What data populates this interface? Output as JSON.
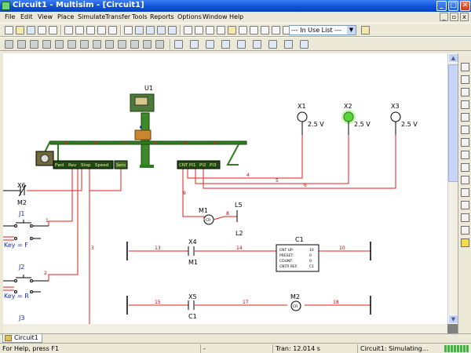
{
  "window": {
    "title": "Circuit1 - Multisim - [Circuit1]"
  },
  "title_buttons": [
    "_",
    "□",
    "✕"
  ],
  "menu": [
    {
      "label": "File"
    },
    {
      "label": "Edit"
    },
    {
      "label": "View"
    },
    {
      "label": "Place"
    },
    {
      "label": "Simulate"
    },
    {
      "label": "Transfer"
    },
    {
      "label": "Tools"
    },
    {
      "label": "Reports"
    },
    {
      "label": "Options"
    },
    {
      "label": "Window"
    },
    {
      "label": "Help"
    }
  ],
  "toolbar": {
    "in_use_list": "--- In Use List ---"
  },
  "schematic": {
    "u1": "U1",
    "conveyor_buttons": [
      "Fwd",
      "Rev",
      "Stop",
      "Speed"
    ],
    "conveyor_out": "Sens",
    "counter_pins": [
      "CNT",
      "PI1",
      "PI2",
      "PI3"
    ],
    "lamps": [
      {
        "name": "X1",
        "voltage": "2.5 V",
        "lit": false
      },
      {
        "name": "X2",
        "voltage": "2.5 V",
        "lit": true
      },
      {
        "name": "X3",
        "voltage": "2.5 V",
        "lit": false
      }
    ],
    "x6": "X6",
    "m2_top": "M2",
    "j1": "J1",
    "j1_key": "Key = F",
    "j2": "J2",
    "j2_key": "Key = R",
    "j3": "J3",
    "m1": "M1",
    "l5": "L5",
    "l2": "L2",
    "x4": "X4",
    "x4_sub": "M1",
    "c1": "C1",
    "c1_fields": [
      {
        "k": "CNT UP:",
        "v": "10"
      },
      {
        "k": "PRESET:",
        "v": "0"
      },
      {
        "k": "COUNT:",
        "v": "0"
      },
      {
        "k": "CNTR REF:",
        "v": "C1"
      }
    ],
    "x5": "X5",
    "x5_sub": "C1",
    "m2": "M2",
    "coil_label": "CR",
    "nets": [
      "1",
      "2",
      "3",
      "4",
      "5",
      "6",
      "8",
      "9",
      "10",
      "13",
      "14",
      "15",
      "17",
      "18"
    ]
  },
  "tabs": [
    {
      "label": "Circuit1"
    }
  ],
  "status": {
    "help": "For Help, press F1",
    "blank": "-",
    "tran": "Tran: 12.014 s",
    "sim": "Circuit1: Simulating..."
  },
  "colors": {
    "wire": "#e0221e",
    "net_label": "#c00000",
    "rail": "#000000",
    "conveyor": "#2f7d1f",
    "lamp_on": "#5cd23c",
    "title_blue": "#0a51d6"
  }
}
